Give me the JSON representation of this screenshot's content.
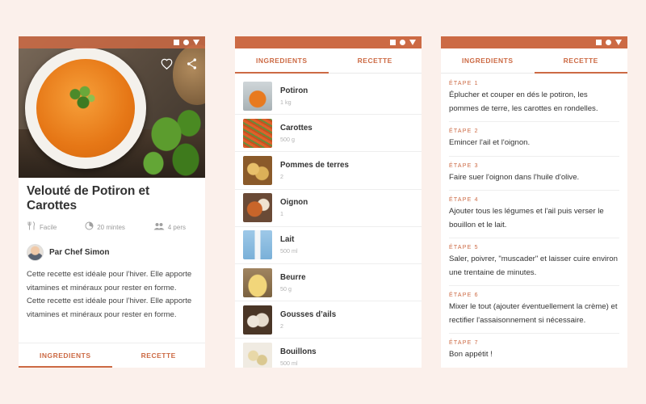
{
  "colors": {
    "accent": "#cc6a44",
    "background": "#fbf0eb"
  },
  "status_icons": [
    "square-icon",
    "circle-icon",
    "triangle-icon"
  ],
  "detail": {
    "title": "Velouté de Potiron et Carottes",
    "meta": [
      {
        "icon": "utensils-icon",
        "label": "Facile"
      },
      {
        "icon": "timer-icon",
        "label": "20 mintes"
      },
      {
        "icon": "people-icon",
        "label": "4 pers"
      }
    ],
    "author": "Par Chef Simon",
    "description": "Cette recette est idéale pour l’hiver. Elle apporte vitamines et minéraux pour rester en forme. Cette recette est idéale pour l’hiver. Elle apporte vitamines et minéraux pour rester en forme.",
    "tabs": [
      "INGREDIENTS",
      "RECETTE"
    ],
    "active_tab": "INGREDIENTS"
  },
  "ingredients_screen": {
    "tabs": [
      "INGREDIENTS",
      "RECETTE"
    ],
    "active_tab": "INGREDIENTS",
    "items": [
      {
        "name": "Potiron",
        "qty": "1 kg"
      },
      {
        "name": "Carottes",
        "qty": "500 g"
      },
      {
        "name": "Pommes de terres",
        "qty": "2"
      },
      {
        "name": "Oignon",
        "qty": "1"
      },
      {
        "name": "Lait",
        "qty": "500 ml"
      },
      {
        "name": "Beurre",
        "qty": "50 g"
      },
      {
        "name": "Gousses d’ails",
        "qty": "2"
      },
      {
        "name": "Bouillons",
        "qty": "500 ml"
      }
    ]
  },
  "recipe_screen": {
    "tabs": [
      "INGREDIENTS",
      "RECETTE"
    ],
    "active_tab": "RECETTE",
    "steps": [
      {
        "label": "ÉTAPE 1",
        "text": "Éplucher et couper en dés le potiron, les pommes de terre, les carottes en rondelles."
      },
      {
        "label": "ÉTAPE 2",
        "text": "Emincer l'ail et l'oignon."
      },
      {
        "label": "ÉTAPE 3",
        "text": "Faire suer l'oignon dans l'huile d'olive."
      },
      {
        "label": "ÉTAPE 4",
        "text": "Ajouter tous les légumes et l'ail puis verser le bouillon et le lait."
      },
      {
        "label": "ÉTAPE 5",
        "text": "Saler, poivrer, \"muscader\" et laisser cuire environ une trentaine de minutes."
      },
      {
        "label": "ÉTAPE 6",
        "text": "Mixer le tout (ajouter éventuellement la crème) et rectifier l'assaisonnement si nécessaire."
      },
      {
        "label": "ÉTAPE 7",
        "text": "Bon appétit !"
      }
    ]
  }
}
